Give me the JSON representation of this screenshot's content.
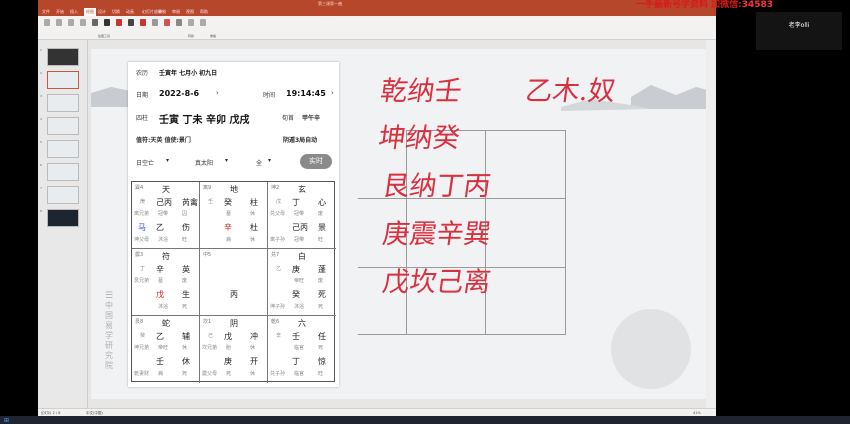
{
  "titlebar": {
    "title": "第三课第一遍",
    "app": "PowerPoint"
  },
  "watermark": {
    "prefix": "一手最新号学资料 加微信:",
    "id": "34583",
    "colors": {
      "prefix": "#d81b1b",
      "id": "#ff3333"
    }
  },
  "menu": {
    "items": [
      "文件",
      "开始",
      "插入",
      "绘图",
      "设计",
      "切换",
      "动画",
      "幻灯片放映",
      "录制",
      "审阅",
      "视图",
      "帮助"
    ],
    "active_index": 3
  },
  "ribbon": {
    "groups": [
      "绘图工具",
      "转换",
      "重播"
    ]
  },
  "thumbnails": {
    "count": 8,
    "selected": 2
  },
  "statusbar": {
    "slide": "幻灯片 2 / 8",
    "lang": "中文(中国)",
    "zoom": "41%"
  },
  "video": {
    "name": "老李olli"
  },
  "panel": {
    "nongli_label": "农历",
    "nongli_value": "壬寅年 七月小 初九日",
    "riqi_label": "日期",
    "riqi_value": "2022-8-6",
    "shijian_label": "时间",
    "shijian_value": "19:14:45",
    "sizhu_label": "四柱",
    "sizhu_value": "壬寅 丁未 辛卯 戊戌",
    "xunshou_label": "旬首",
    "xunshou_value": "甲午辛",
    "zhifu": "值符:天英 值使:景门",
    "ju": "阴遁3局自动",
    "kongwang": "日空亡",
    "zhentaiyang": "真太阳",
    "quan": "全",
    "shishi": "实时",
    "side_text": "中国易学研究院"
  },
  "palaces": [
    {
      "num": "巽4",
      "shen": "天",
      "star1": "己丙",
      "star2": "芮禽",
      "g1": "庚",
      "small": [
        "离兄弟",
        "冠带",
        "囚"
      ],
      "men": "乙",
      "men2": "伤",
      "mark": "马",
      "small2": [
        "坤父母",
        "沐浴",
        "旺"
      ]
    },
    {
      "num": "离9",
      "shen": "地",
      "star1": "癸",
      "star2": "柱",
      "g1": "壬",
      "small": [
        "",
        "墓",
        "休"
      ],
      "men": "辛",
      "men2": "杜",
      "small2": [
        "",
        "病",
        "休"
      ]
    },
    {
      "num": "坤2",
      "shen": "玄",
      "star1": "丁",
      "star2": "心",
      "g1": "戊",
      "small": [
        "兑父母",
        "冠带",
        "废"
      ],
      "men": "己丙",
      "men2": "景",
      "small2": [
        "离子孙",
        "冠带",
        "旺"
      ]
    },
    {
      "num": "震3",
      "shen": "符",
      "star1": "辛",
      "star2": "英",
      "g1": "丁",
      "small": [
        "艮兄弟",
        "墓",
        "废"
      ],
      "men": "戊",
      "men2": "生",
      "small2": [
        "",
        "沐浴",
        "死"
      ]
    },
    {
      "num": "中5",
      "shen": "",
      "star1": "",
      "star2": "",
      "g1": "",
      "small": [
        "",
        "",
        ""
      ],
      "men": "丙",
      "men2": "",
      "small2": [
        "",
        "",
        ""
      ]
    },
    {
      "num": "兑7",
      "shen": "白",
      "star1": "庚",
      "star2": "蓬",
      "g1": "乙",
      "small": [
        "",
        "帝旺",
        "废"
      ],
      "men": "癸",
      "men2": "死",
      "small2": [
        "坤子孙",
        "沐浴",
        "死"
      ]
    },
    {
      "num": "艮8",
      "shen": "蛇",
      "star1": "乙",
      "star2": "辅",
      "g1": "癸",
      "small": [
        "坤兄弟",
        "帝旺",
        "休"
      ],
      "men": "壬",
      "men2": "休",
      "small2": [
        "乾妻财",
        "病",
        "死"
      ]
    },
    {
      "num": "坎1",
      "shen": "阴",
      "star1": "戊",
      "star2": "冲",
      "g1": "己",
      "small": [
        "坎兄弟",
        "胎",
        "休"
      ],
      "men": "庚",
      "men2": "开",
      "small2": [
        "震父母",
        "死",
        "休"
      ]
    },
    {
      "num": "乾6",
      "shen": "六",
      "star1": "壬",
      "star2": "任",
      "g1": "辛",
      "small": [
        "",
        "临官",
        "死"
      ],
      "men": "丁",
      "men2": "惊",
      "small2": [
        "兑子孙",
        "临官",
        "旺"
      ]
    }
  ],
  "handwriting": [
    "乾纳壬",
    "乙木.奴",
    "坤纳癸",
    "艮纳丁丙",
    "庚震辛巽",
    "戊坎己离"
  ],
  "colors": {
    "accent": "#b7472a",
    "ink": "#d93040"
  }
}
